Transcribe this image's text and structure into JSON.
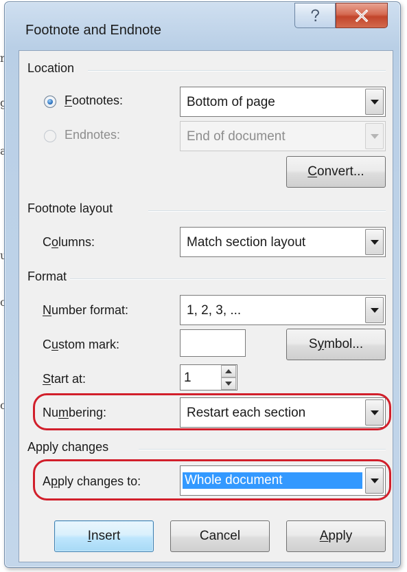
{
  "window": {
    "title": "Footnote and Endnote",
    "help_icon": "question-mark-icon",
    "close_icon": "close-x-icon",
    "title_gradient": "#c3d6ea",
    "close_color": "#c2452c"
  },
  "location": {
    "heading": "Location",
    "footnotes_label": "Footnotes:",
    "footnotes_selected": true,
    "footnotes_value": "Bottom of page",
    "endnotes_label": "Endnotes:",
    "endnotes_value": "End of document",
    "convert_label": "Convert..."
  },
  "layout": {
    "heading": "Footnote layout",
    "columns_label": "Columns:",
    "columns_value": "Match section layout"
  },
  "format": {
    "heading": "Format",
    "number_format_label": "Number format:",
    "number_format_value": "1, 2, 3, ...",
    "custom_mark_label": "Custom mark:",
    "custom_mark_value": "",
    "symbol_label": "Symbol...",
    "start_at_label": "Start at:",
    "start_at_value": "1",
    "numbering_label": "Numbering:",
    "numbering_value": "Restart each section"
  },
  "apply": {
    "heading": "Apply changes",
    "apply_to_label": "Apply changes to:",
    "apply_to_value": "Whole document"
  },
  "buttons": {
    "insert": "Insert",
    "cancel": "Cancel",
    "apply": "Apply"
  },
  "colors": {
    "selection_highlight": "#3399ff",
    "annotation_red": "#d11f2b",
    "dialog_bg": "#f0f0f0"
  }
}
